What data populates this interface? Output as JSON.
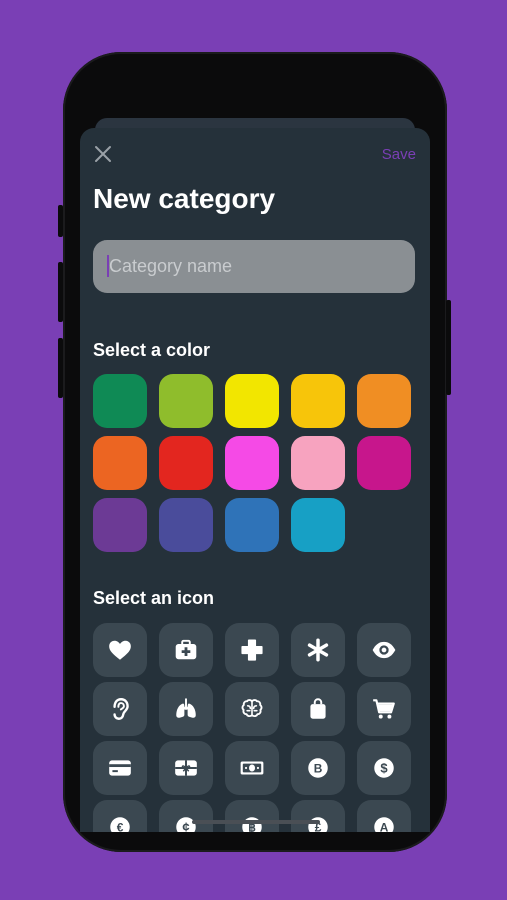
{
  "header": {
    "save_label": "Save",
    "title": "New category"
  },
  "name_field": {
    "placeholder": "Category name",
    "value": ""
  },
  "colors": {
    "label": "Select a color",
    "swatches": [
      "#0f8a55",
      "#8fbd2c",
      "#f2e600",
      "#f7c50a",
      "#f08e23",
      "#ec6522",
      "#e3261f",
      "#f54ae6",
      "#f7a3bf",
      "#c7168c",
      "#6c3a95",
      "#4a4c9b",
      "#2f73b8",
      "#17a0c5"
    ]
  },
  "icons": {
    "label": "Select an icon",
    "items": [
      "heart-icon",
      "first-aid-kit-icon",
      "plus-cross-icon",
      "asterisk-icon",
      "eye-icon",
      "ear-icon",
      "lungs-icon",
      "brain-icon",
      "shopping-bag-icon",
      "shopping-cart-icon",
      "credit-card-icon",
      "gift-card-icon",
      "banknote-icon",
      "bitcoin-icon",
      "dollar-coin-icon",
      "euro-coin-icon",
      "cent-coin-icon",
      "baht-coin-icon",
      "pound-coin-icon",
      "austral-coin-icon"
    ]
  }
}
